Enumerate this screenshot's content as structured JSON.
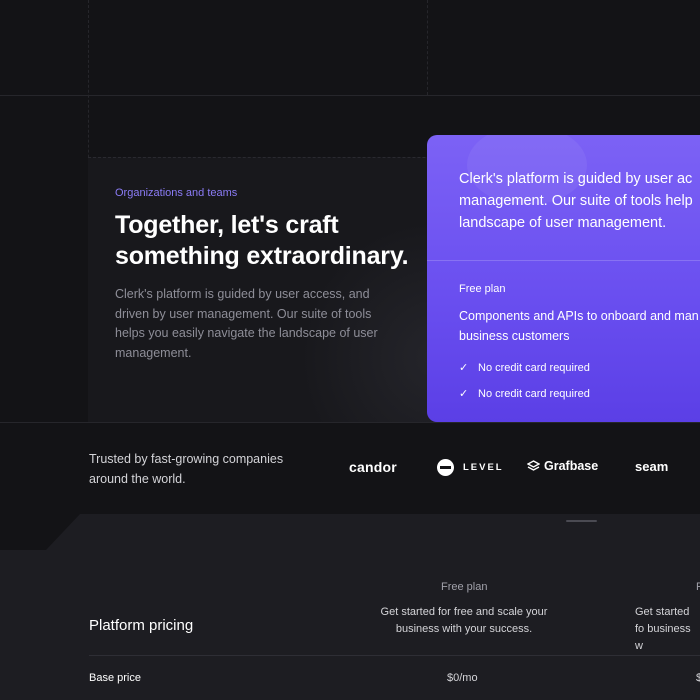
{
  "hero": {
    "eyebrow": "Organizations and teams",
    "title": "Together, let's craft something extraordinary.",
    "body": "Clerk's platform is guided by user access, and driven by user management. Our suite of tools helps you easily navigate the landscape of user management."
  },
  "feature_card": {
    "quote_line1": "Clerk's platform is guided by user ac",
    "quote_line2": "management. Our suite of tools help",
    "quote_line3": "landscape of user management.",
    "plan_label": "Free plan",
    "desc_line1": "Components and APIs to onboard and man",
    "desc_line2": "business customers",
    "checks": [
      "No credit card required",
      "No credit card required"
    ],
    "accent_color": "#6a4ff0"
  },
  "trusted": {
    "text": "Trusted by fast-growing companies around the world.",
    "logos": [
      "candor",
      "LEVEL",
      "Grafbase",
      "seam"
    ]
  },
  "pricing": {
    "title": "Platform pricing",
    "columns": [
      {
        "head": "Free plan",
        "desc": "Get started for free and scale your business with your success."
      },
      {
        "head": "P",
        "desc": "Get started fo business w"
      }
    ],
    "rows": [
      {
        "label": "Base price",
        "values": [
          "$0/mo",
          "$"
        ]
      }
    ]
  }
}
